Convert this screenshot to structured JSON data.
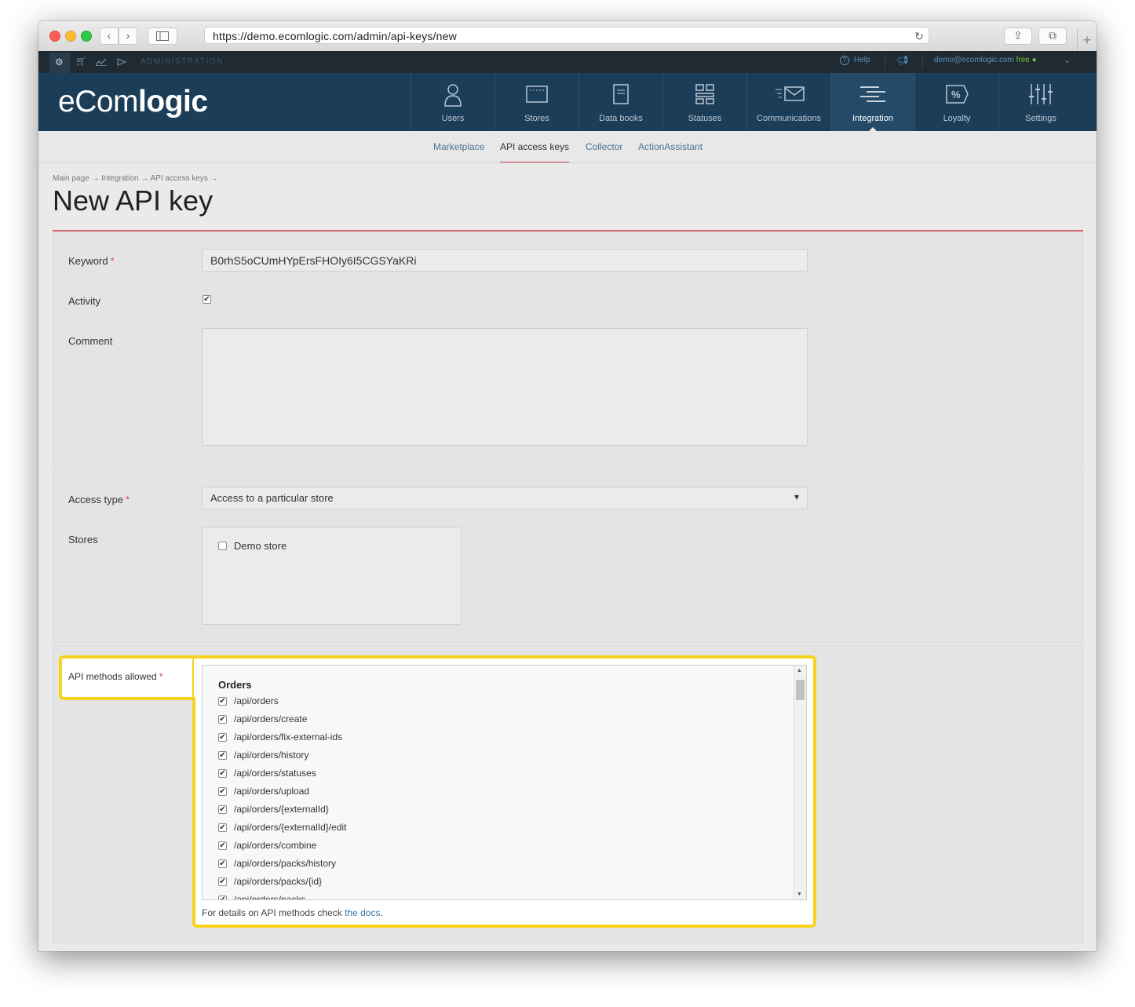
{
  "browser": {
    "url": "https://demo.ecomlogic.com/admin/api-keys/new",
    "back_glyph": "‹",
    "forward_glyph": "›",
    "reload_glyph": "↻",
    "share_glyph": "⇪",
    "tabs_glyph": "⧉",
    "new_tab_glyph": "+"
  },
  "topbar": {
    "section_label": "ADMINISTRATION",
    "help_label": "Help",
    "user_email": "demo@ecomlogic.com",
    "plan": "free"
  },
  "header": {
    "logo_light": "eCom",
    "logo_bold": "logic",
    "nav": [
      {
        "label": "Users",
        "icon": "user-icon"
      },
      {
        "label": "Stores",
        "icon": "store-icon"
      },
      {
        "label": "Data books",
        "icon": "book-icon"
      },
      {
        "label": "Statuses",
        "icon": "statuses-icon"
      },
      {
        "label": "Communications",
        "icon": "mail-icon"
      },
      {
        "label": "Integration",
        "icon": "integration-icon"
      },
      {
        "label": "Loyalty",
        "icon": "percent-tag-icon"
      },
      {
        "label": "Settings",
        "icon": "sliders-icon"
      }
    ],
    "active_nav": "Integration"
  },
  "subnav": {
    "items": [
      "Marketplace",
      "API access keys",
      "Collector",
      "ActionAssistant"
    ],
    "active": "API access keys"
  },
  "breadcrumb": "Main page → Integration → API access keys →",
  "page_title": "New API key",
  "form": {
    "keyword": {
      "label": "Keyword",
      "value": "B0rhS5oCUmHYpErsFHOIy6I5CGSYaKRi",
      "required": "*"
    },
    "activity": {
      "label": "Activity",
      "checked": true,
      "check_glyph": "✔"
    },
    "comment": {
      "label": "Comment",
      "value": ""
    },
    "access_type": {
      "label": "Access type",
      "value": "Access to a particular store",
      "required": "*",
      "arrow": "▾"
    },
    "stores": {
      "label": "Stores",
      "options": [
        {
          "label": "Demo store",
          "checked": false
        }
      ]
    },
    "api_methods": {
      "label": "API methods allowed",
      "required": "*",
      "group": "Orders",
      "items": [
        "/api/orders",
        "/api/orders/create",
        "/api/orders/fix-external-ids",
        "/api/orders/history",
        "/api/orders/statuses",
        "/api/orders/upload",
        "/api/orders/{externalId}",
        "/api/orders/{externalId}/edit",
        "/api/orders/combine",
        "/api/orders/packs/history",
        "/api/orders/packs/{id}",
        "/api/orders/packs"
      ],
      "note_prefix": "For details on API methods check ",
      "note_link": "the docs",
      "note_suffix": "."
    }
  },
  "colors": {
    "header_bg": "#1c3d57",
    "topbar_bg": "#1f2a33",
    "accent_red": "#d0495a",
    "highlight": "#f7d21e",
    "link": "#4c7393"
  }
}
